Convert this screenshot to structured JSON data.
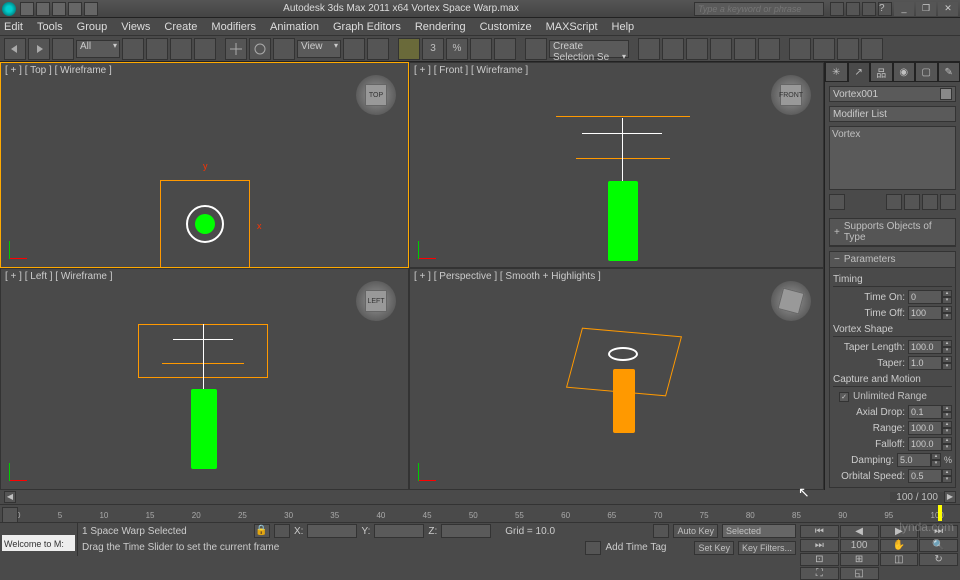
{
  "title": "Autodesk 3ds Max 2011 x64    Vortex Space Warp.max",
  "keyword_placeholder": "Type a keyword or phrase",
  "menus": [
    "Edit",
    "Tools",
    "Group",
    "Views",
    "Create",
    "Modifiers",
    "Animation",
    "Graph Editors",
    "Rendering",
    "Customize",
    "MAXScript",
    "Help"
  ],
  "toolbar": {
    "filter": "All",
    "coord": "View",
    "sel_mode": "Create Selection Se"
  },
  "viewports": {
    "top": "[ + ] [ Top ] [ Wireframe ]",
    "front": "[ + ] [ Front ] [ Wireframe ]",
    "left": "[ + ] [ Left ] [ Wireframe ]",
    "persp": "[ + ] [ Perspective ] [ Smooth + Highlights ]",
    "cube_top": "TOP",
    "cube_front": "FRONT",
    "cube_left": "LEFT"
  },
  "panel": {
    "object_name": "Vortex001",
    "modifier_list": "Modifier List",
    "stack_item": "Vortex",
    "rollout_supports": "Supports Objects of Type",
    "rollout_params": "Parameters",
    "group_timing": "Timing",
    "time_on_lbl": "Time On:",
    "time_on": "0",
    "time_off_lbl": "Time Off:",
    "time_off": "100",
    "group_shape": "Vortex Shape",
    "taper_len_lbl": "Taper Length:",
    "taper_len": "100.0",
    "taper_lbl": "Taper:",
    "taper": "1.0",
    "group_capture": "Capture and Motion",
    "unlimited": "Unlimited Range",
    "axial_lbl": "Axial Drop:",
    "axial": "0.1",
    "range_lbl": "Range:",
    "range": "100.0",
    "falloff_lbl": "Falloff:",
    "falloff": "100.0",
    "damping_lbl": "Damping:",
    "damping": "5.0",
    "orbital_lbl": "Orbital Speed:",
    "orbital": "0.5"
  },
  "timeslider": "100 / 100",
  "ruler_ticks": [
    "0",
    "5",
    "10",
    "15",
    "20",
    "25",
    "30",
    "35",
    "40",
    "45",
    "50",
    "55",
    "60",
    "65",
    "70",
    "75",
    "80",
    "85",
    "90",
    "95",
    "100"
  ],
  "status": {
    "welcome": "Welcome to M:",
    "selection": "1 Space Warp Selected",
    "prompt": "Drag the Time Slider to set the current frame",
    "x_lbl": "X:",
    "y_lbl": "Y:",
    "z_lbl": "Z:",
    "grid": "Grid = 10.0",
    "autokey": "Auto Key",
    "setkey": "Set Key",
    "selected": "Selected",
    "keyfilters": "Key Filters...",
    "addtag": "Add Time Tag",
    "frame": "100"
  },
  "watermark": "lynda.com"
}
